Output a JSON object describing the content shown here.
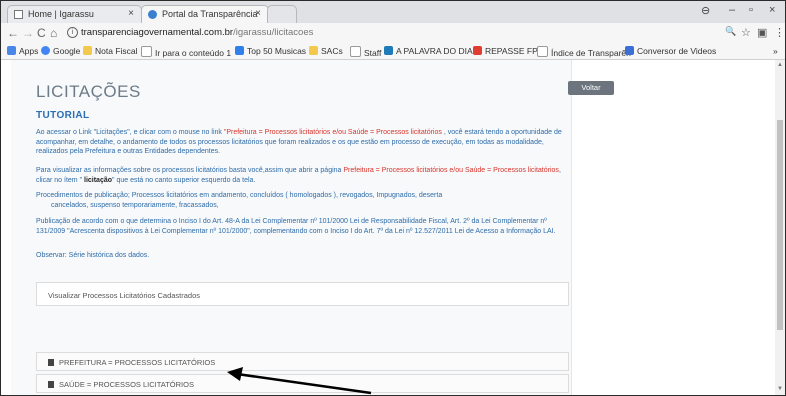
{
  "tabs": [
    {
      "title": "Home | Igarassu",
      "close": "×"
    },
    {
      "title": "Portal da Transparência",
      "close": "×"
    }
  ],
  "window_controls": {
    "profile": "⊖",
    "minimize": "–",
    "maximize": "▫",
    "close": "×"
  },
  "address_bar": {
    "host": "transparenciagovernamental.com.br",
    "path": "/igarassu/licitacoes"
  },
  "nav": {
    "back": "←",
    "forward": "→",
    "reload": "C",
    "home": "⌂"
  },
  "toolbar_icons": {
    "zoom": "🔍",
    "star": "☆",
    "ext": "▣",
    "menu": "⋮"
  },
  "bookmarks": [
    {
      "label": "Apps",
      "color": "#4a86e8"
    },
    {
      "label": "Google",
      "color": "#4285f4"
    },
    {
      "label": "Nota Fiscal",
      "color": "#f2c94c"
    },
    {
      "label": "Ir para o conteúdo 1",
      "color": "#bdbdbd"
    },
    {
      "label": "Top 50 Musicas",
      "color": "#2f80ed"
    },
    {
      "label": "SACs",
      "color": "#f2c94c"
    },
    {
      "label": "Staff",
      "color": "#bdbdbd"
    },
    {
      "label": "A PALAVRA DO DIA",
      "color": "#1f7ab8"
    },
    {
      "label": "REPASSE FPM",
      "color": "#e03c31"
    },
    {
      "label": "Índice de Transparên",
      "color": "#bdbdbd"
    },
    {
      "label": "Conversor de Videos",
      "color": "#3a6fd8"
    }
  ],
  "bookmarks_more": "»",
  "page": {
    "title": "LICITAÇÕES",
    "subtitle": "TUTORIAL",
    "p1_a": "Ao acessar o Link \"Licitações\", e clicar com o mouse no link ",
    "p1_red": "\"Prefeitura = Processos licitatórios e/ou Saúde = Processos licitatórios",
    "p1_b": " , você estará tendo a oportunidade de acompanhar, em detalhe, o andamento de todos os processos licitatórios que foram realizados e os que estão em processo de execução, em todas as modalidade, realizados pela Prefeitura e outras Entidades dependentes.",
    "p2_a": "Para visualizar as informações sobre os processos licitatórios basta você,assim que abrir a página ",
    "p2_red": "Prefeitura = Processos licitatórios e/ou Saúde = Processos licitatórios",
    "p2_b": ", clicar no ítem \" ",
    "p2_bold": "licitação",
    "p2_c": "\" que está no canto superior esquerdo da tela.",
    "p3_a": "Procedimentos de publicação; Processos licitatórios em andamento, concluídos ( homologados ), revogados, Impugnados, deserta",
    "p3_b": "cancelados, suspenso temporariamente, fracassados,",
    "p4": "Publicação de acordo com o que determina o Inciso I do Art. 48-A da Lei Complementar nº 101/2000 Lei de Responsabilidade Fiscal, Art. 2º da Lei Complementar nº 131/2009 \"Acrescenta dispositivos à Lei Complementar nº 101/2000\", complementando com o Inciso I do Art. 7º da Lei nº 12.527/2011 Lei de Acesso a Informação LAI.",
    "p5": "Observar: Série histórica dos dados.",
    "view_link": "Visualizar Processos Licitatórios Cadastrados",
    "list_items": [
      "PREFEITURA = PROCESSOS LICITATÓRIOS",
      "SAÚDE = PROCESSOS LICITATÓRIOS"
    ],
    "back_button": "Voltar"
  }
}
